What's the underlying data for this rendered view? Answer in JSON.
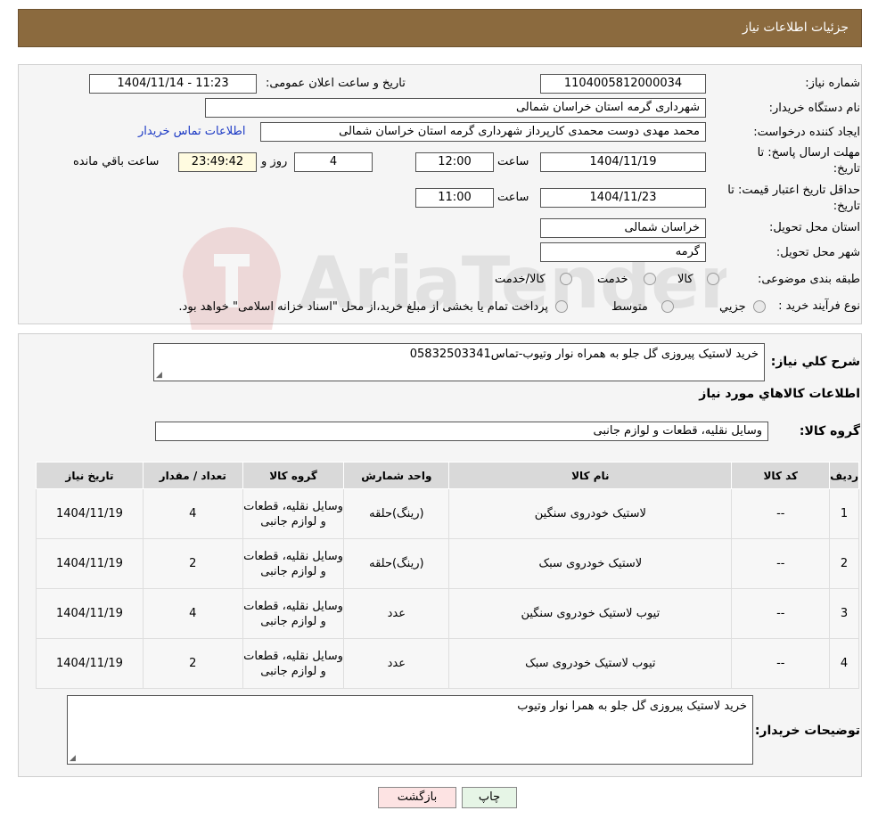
{
  "header": {
    "title": "جزئیات اطلاعات نیاز"
  },
  "fields": {
    "need_number_label": "شماره نیاز:",
    "need_number": "1104005812000034",
    "announce_label": "تاریخ و ساعت اعلان عمومی:",
    "announce_value": "1404/11/14 - 11:23",
    "buyer_org_label": "نام دستگاه خریدار:",
    "buyer_org": "شهرداری گرمه استان خراسان شمالی",
    "requester_label": "ایجاد کننده درخواست:",
    "requester": "محمد مهدی دوست محمدی کارپرداز شهرداری گرمه استان خراسان شمالی",
    "contact_link": "اطلاعات تماس خریدار",
    "deadline_label_1": "مهلت ارسال پاسخ: تا",
    "deadline_label_2": "تاریخ:",
    "deadline_date": "1404/11/19",
    "time_label": "ساعت",
    "deadline_time": "12:00",
    "days_value": "4",
    "days_label": "روز و",
    "remaining_time": "23:49:42",
    "remaining_label": "ساعت باقي مانده",
    "validity_label_1": "حداقل تاریخ اعتبار قیمت: تا",
    "validity_label_2": "تاریخ:",
    "validity_date": "1404/11/23",
    "validity_time": "11:00",
    "province_label": "استان محل تحویل:",
    "province": "خراسان شمالی",
    "city_label": "شهر محل تحویل:",
    "city": "گرمه",
    "category_label": "طبقه بندی موضوعی:",
    "category_options": [
      "کالا",
      "خدمت",
      "کالا/خدمت"
    ],
    "process_label": "نوع فرآیند خرید :",
    "process_options": [
      "جزیي",
      "متوسط"
    ],
    "process_note": "پرداخت تمام یا بخشی از مبلغ خرید،از محل \"اسناد خزانه اسلامی\" خواهد بود."
  },
  "description": {
    "label": "شرح کلي نياز:",
    "text": "خرید لاستیک پیروزی گل جلو به همراه نوار وتیوب-تماس05832503341"
  },
  "goods_section": {
    "title": "اطلاعات کالاهاي مورد نياز",
    "group_label": "گروه کالا:",
    "group_value": "وسایل نقلیه، قطعات و لوازم جانبی"
  },
  "table": {
    "headers": [
      "رديف",
      "کد کالا",
      "نام کالا",
      "واحد شمارش",
      "گروه کالا",
      "تعداد / مقدار",
      "تاریخ نیاز"
    ],
    "rows": [
      {
        "idx": "1",
        "code": "--",
        "name": "لاستیک خودروی سنگین",
        "unit": "(رینگ)حلقه",
        "group": "وسایل نقلیه، قطعات و لوازم جانبی",
        "qty": "4",
        "date": "1404/11/19"
      },
      {
        "idx": "2",
        "code": "--",
        "name": "لاستیک خودروی سبک",
        "unit": "(رینگ)حلقه",
        "group": "وسایل نقلیه، قطعات و لوازم جانبی",
        "qty": "2",
        "date": "1404/11/19"
      },
      {
        "idx": "3",
        "code": "--",
        "name": "تیوب لاستیک خودروی سنگین",
        "unit": "عدد",
        "group": "وسایل نقلیه، قطعات و لوازم جانبی",
        "qty": "4",
        "date": "1404/11/19"
      },
      {
        "idx": "4",
        "code": "--",
        "name": "تیوب لاستیک خودروی سبک",
        "unit": "عدد",
        "group": "وسایل نقلیه، قطعات و لوازم جانبی",
        "qty": "2",
        "date": "1404/11/19"
      }
    ]
  },
  "buyer_notes": {
    "label": "توضیحات خریدار:",
    "text": "خرید لاستیک پیروزی گل جلو به همرا نوار وتیوب"
  },
  "buttons": {
    "print": "چاپ",
    "back": "بازگشت"
  },
  "watermark": {
    "text": "AriaTender.neT"
  },
  "colors": {
    "header_bg": "#8b6a3e",
    "link": "#1a38c4",
    "back_button_bg": "#fde3e3",
    "print_button_bg": "#e6f5e6"
  }
}
